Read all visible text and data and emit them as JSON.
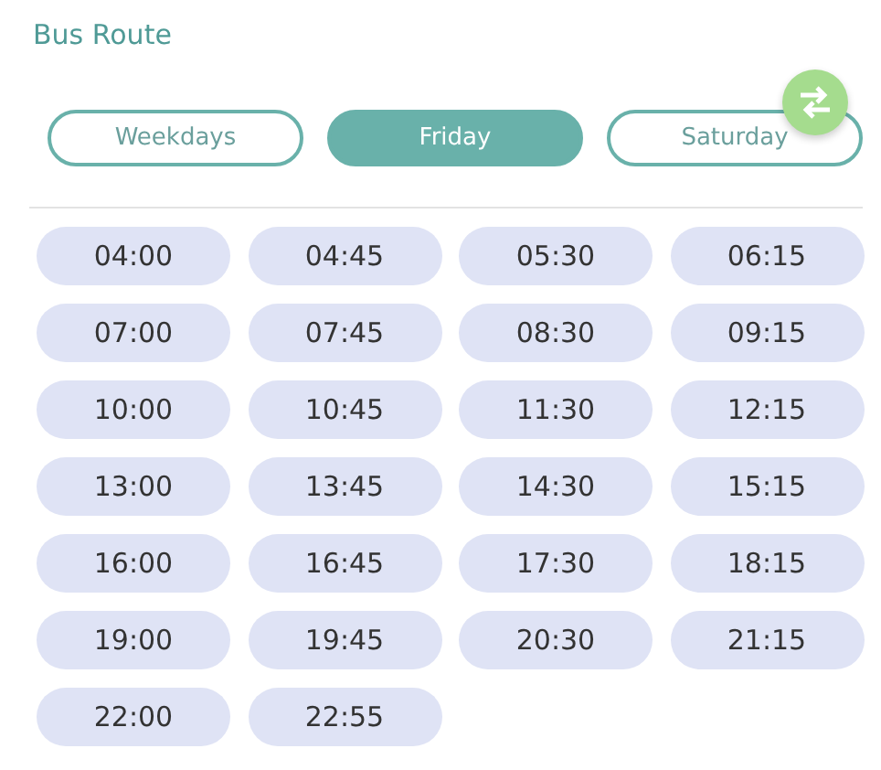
{
  "title": "Bus Route",
  "tabs": [
    {
      "label": "Weekdays",
      "selected": false
    },
    {
      "label": "Friday",
      "selected": true
    },
    {
      "label": "Saturday",
      "selected": false
    }
  ],
  "times": [
    "04:00",
    "04:45",
    "05:30",
    "06:15",
    "07:00",
    "07:45",
    "08:30",
    "09:15",
    "10:00",
    "10:45",
    "11:30",
    "12:15",
    "13:00",
    "13:45",
    "14:30",
    "15:15",
    "16:00",
    "16:45",
    "17:30",
    "18:15",
    "19:00",
    "19:45",
    "20:30",
    "21:15",
    "22:00",
    "22:55"
  ]
}
